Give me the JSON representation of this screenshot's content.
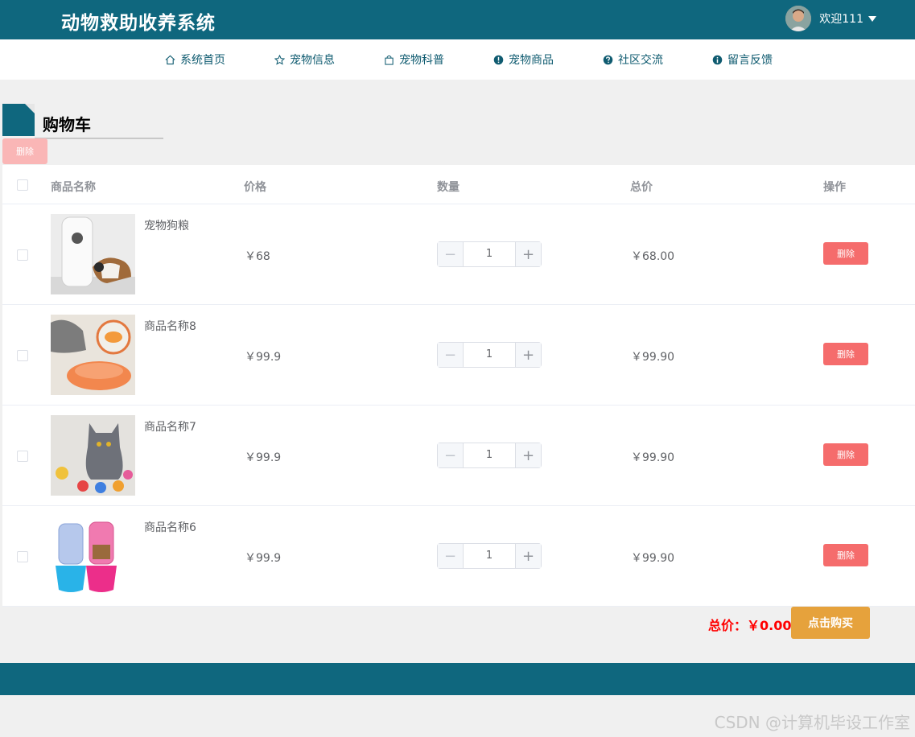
{
  "app": {
    "title": "动物救助收养系统"
  },
  "user": {
    "greeting": "欢迎111"
  },
  "nav": {
    "items": [
      {
        "label": "系统首页",
        "icon": "home-icon"
      },
      {
        "label": "宠物信息",
        "icon": "star-icon"
      },
      {
        "label": "宠物科普",
        "icon": "bag-icon"
      },
      {
        "label": "宠物商品",
        "icon": "info-circle-icon"
      },
      {
        "label": "社区交流",
        "icon": "question-circle-icon"
      },
      {
        "label": "留言反馈",
        "icon": "info-icon"
      }
    ]
  },
  "page": {
    "title": "购物车",
    "delete_selected_label": "删除"
  },
  "table": {
    "headers": {
      "name": "商品名称",
      "price": "价格",
      "quantity": "数量",
      "total": "总价",
      "action": "操作"
    },
    "rows": [
      {
        "name": "宠物狗粮",
        "price": "￥68",
        "quantity": "1",
        "total": "￥68.00",
        "delete_label": "删除"
      },
      {
        "name": "商品名称8",
        "price": "￥99.9",
        "quantity": "1",
        "total": "￥99.90",
        "delete_label": "删除"
      },
      {
        "name": "商品名称7",
        "price": "￥99.9",
        "quantity": "1",
        "total": "￥99.90",
        "delete_label": "删除"
      },
      {
        "name": "商品名称6",
        "price": "￥99.9",
        "quantity": "1",
        "total": "￥99.90",
        "delete_label": "删除"
      }
    ]
  },
  "summary": {
    "total_label": "总价：￥0.00",
    "buy_label": "点击购买"
  },
  "watermark": "CSDN @计算机毕设工作室",
  "colors": {
    "primary": "#0f677e",
    "danger": "#f56c6c",
    "warning": "#e6a23c"
  }
}
